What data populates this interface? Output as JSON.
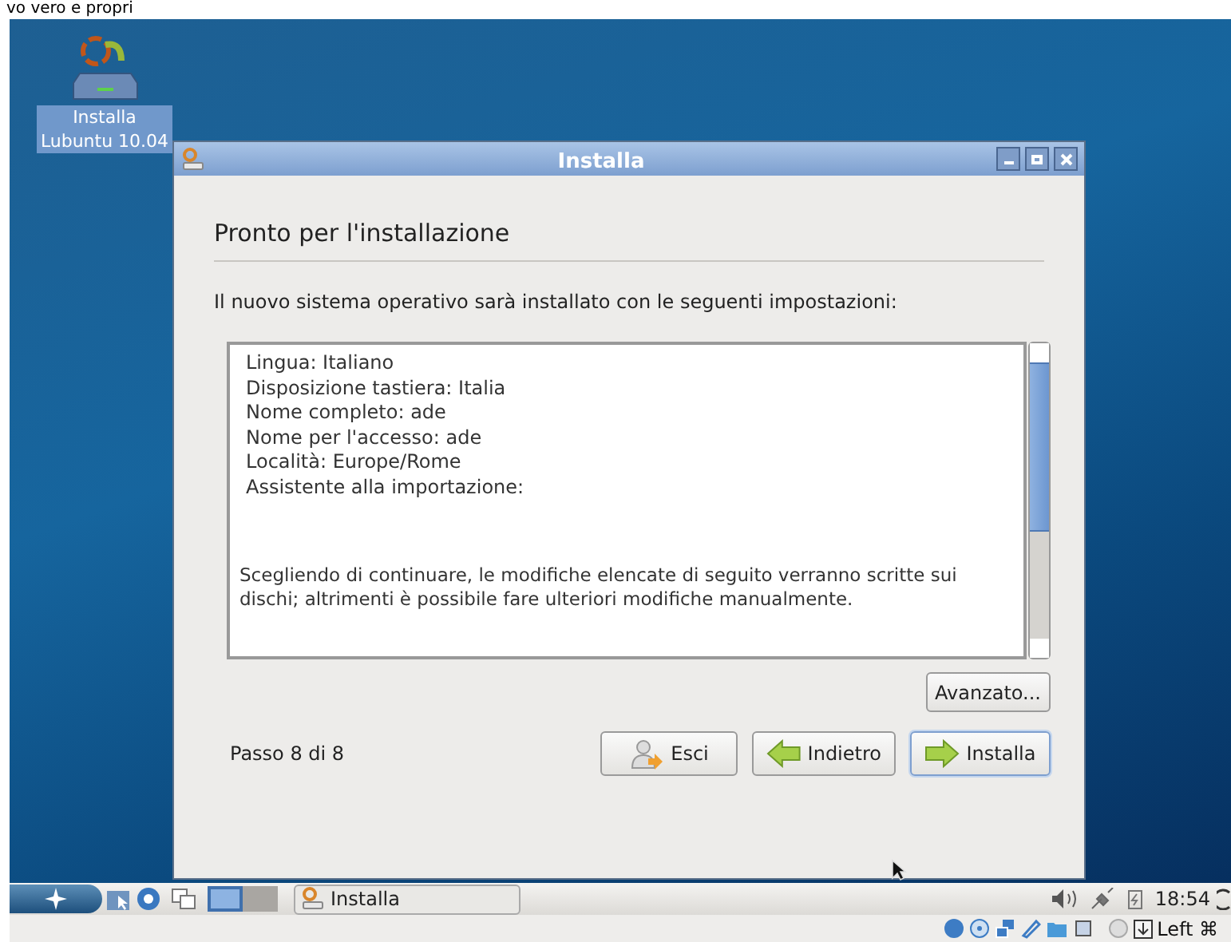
{
  "page_heading": "vo vero e propri",
  "desktop_icons": [
    {
      "label_lines": [
        "Installa",
        "Lubuntu 10.04"
      ],
      "selected": true
    }
  ],
  "window": {
    "title": "Installa",
    "heading": "Pronto per l'installazione",
    "intro": "Il nuovo sistema operativo sarà installato con le seguenti impostazioni:",
    "summary_lines": [
      "Lingua: Italiano",
      "Disposizione tastiera: Italia",
      "Nome completo: ade",
      "Nome per l'accesso: ade",
      "Località: Europe/Rome",
      "Assistente alla importazione:"
    ],
    "summary_note": "Scegliendo di continuare, le modifiche elencate di seguito verranno scritte sui dischi; altrimenti è possibile fare ulteriori modifiche manualmente.",
    "advanced_button": "Avanzato...",
    "step": "Passo 8 di 8",
    "buttons": [
      {
        "kind": "quit",
        "label": "Esci",
        "default": false
      },
      {
        "kind": "back",
        "label": "Indietro",
        "default": false
      },
      {
        "kind": "forward",
        "label": "Installa",
        "default": true
      }
    ]
  },
  "taskbar": {
    "tasks": [
      {
        "label": "Installa"
      }
    ],
    "clock": "18:54"
  },
  "vm_status": {
    "host_key": "Left ⌘"
  }
}
